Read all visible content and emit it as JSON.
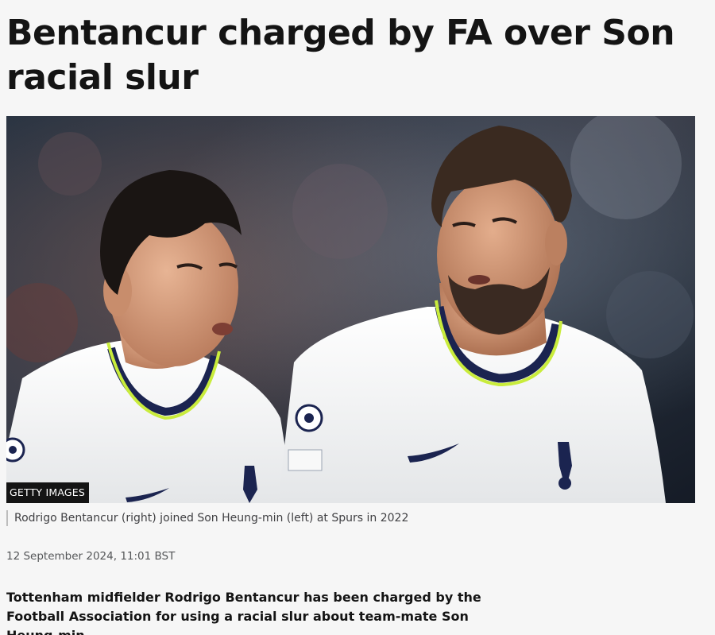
{
  "article": {
    "headline": "Bentancur charged by FA over Son racial slur",
    "image": {
      "credit": "GETTY IMAGES",
      "caption": "Rodrigo Bentancur (right) joined Son Heung-min (left) at Spurs in 2022",
      "subject_icons": [
        "player-left-photo",
        "player-right-photo",
        "champions-league-badge-icon",
        "swoosh-logo-icon",
        "cockerel-crest-icon"
      ]
    },
    "timestamp": "12 September 2024, 11:01 BST",
    "lede": "Tottenham midfielder Rodrigo Bentancur has been charged by the Football Association for using a racial slur about team-mate Son Heung-min."
  },
  "colors": {
    "page_background": "#f6f6f6",
    "text": "#141414",
    "shirt": "#f3f4f2",
    "collar_navy": "#1b2450",
    "collar_lime": "#c9ec3c",
    "credit_background": "#141414"
  }
}
